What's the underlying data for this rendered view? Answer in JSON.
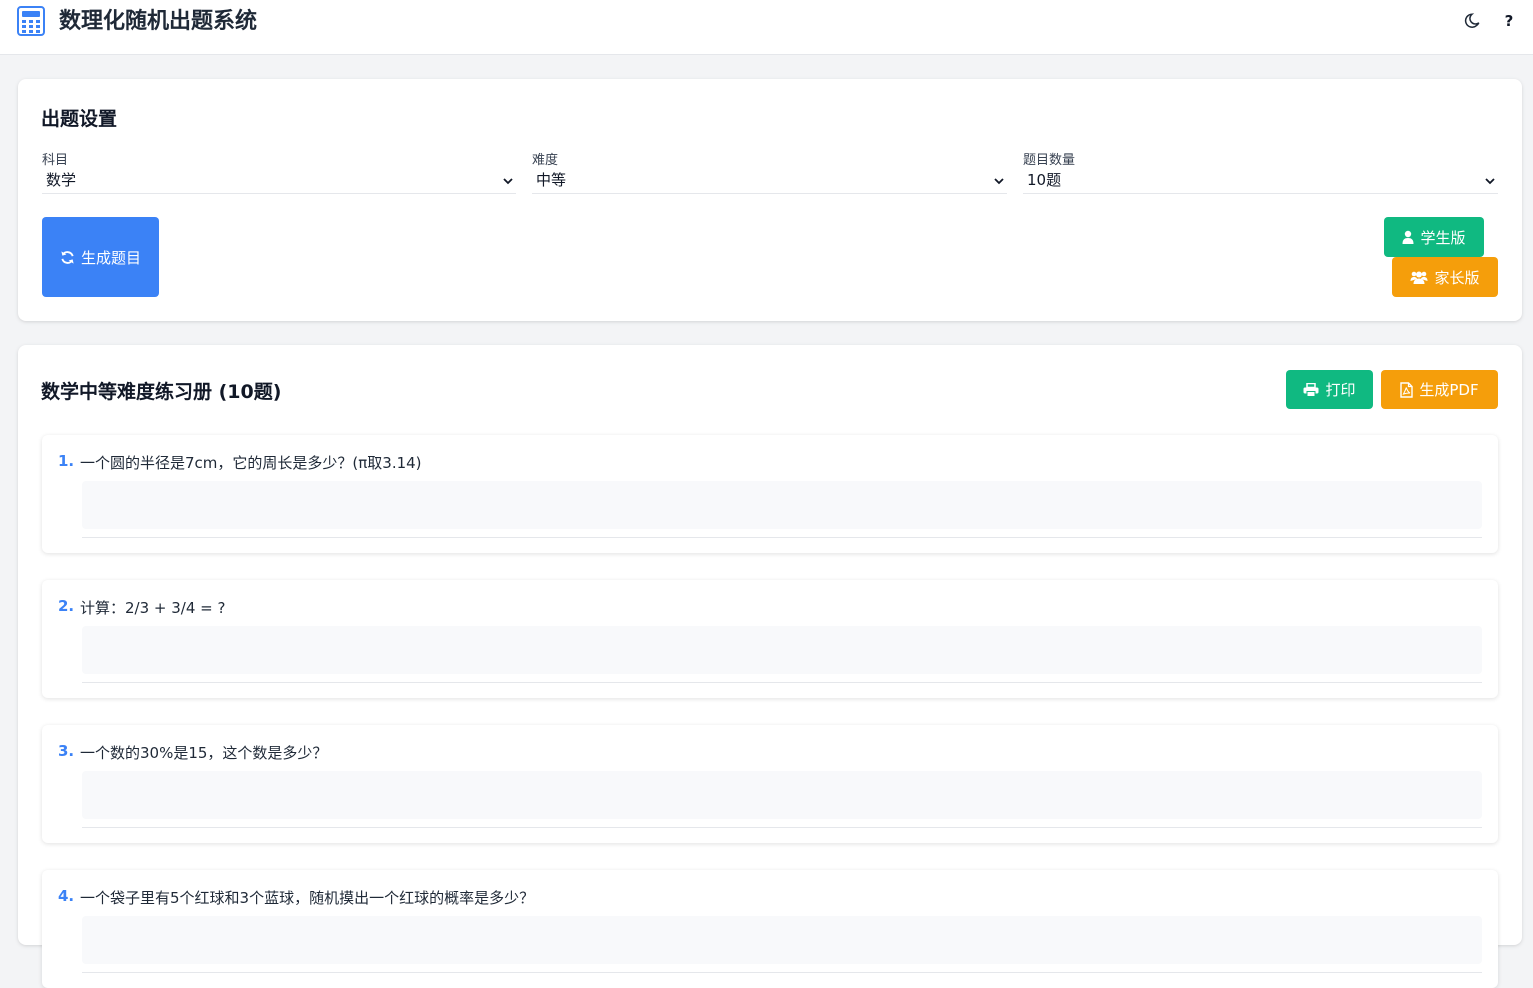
{
  "header": {
    "title": "数理化随机出题系统",
    "logo_icon": "calculator-icon",
    "theme_icon": "moon-icon",
    "help_label": "?"
  },
  "settings": {
    "title": "出题设置",
    "subject": {
      "label": "科目",
      "value": "数学"
    },
    "difficulty": {
      "label": "难度",
      "value": "中等"
    },
    "count": {
      "label": "题目数量",
      "value": "10题"
    },
    "generate_label": "生成题目",
    "generate_icon": "refresh-icon",
    "student_label": "学生版",
    "student_icon": "user-icon",
    "parent_label": "家长版",
    "parent_icon": "users-icon"
  },
  "workbook": {
    "title": "数学中等难度练习册 (10题)",
    "print_label": "打印",
    "print_icon": "printer-icon",
    "pdf_label": "生成PDF",
    "pdf_icon": "pdf-file-icon",
    "questions": [
      {
        "num": "1.",
        "text": "一个圆的半径是7cm，它的周长是多少？(π取3.14)"
      },
      {
        "num": "2.",
        "text": "计算：2/3 + 3/4 = ?"
      },
      {
        "num": "3.",
        "text": "一个数的30%是15，这个数是多少？"
      },
      {
        "num": "4.",
        "text": "一个袋子里有5个红球和3个蓝球，随机摸出一个红球的概率是多少？"
      }
    ]
  },
  "colors": {
    "primary": "#3b82f6",
    "success": "#10b981",
    "warning": "#f59e0b"
  }
}
